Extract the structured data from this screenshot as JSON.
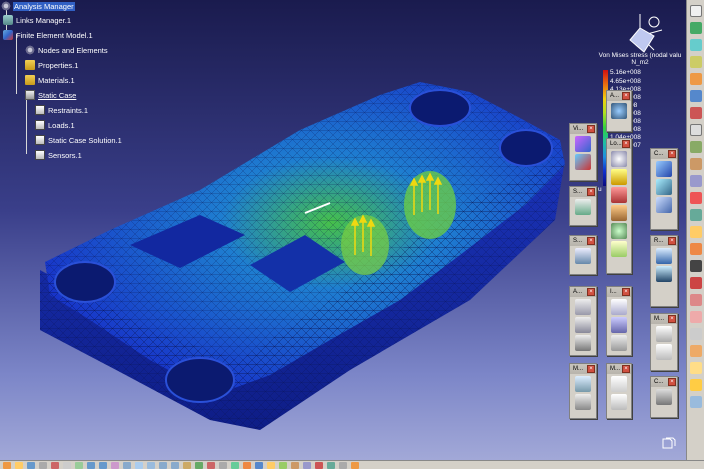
{
  "tree": {
    "items": [
      {
        "label": "Analysis Manager",
        "icon": "gear-icon"
      },
      {
        "label": "Links Manager.1",
        "icon": "link-icon"
      },
      {
        "label": "Finite Element Model.1",
        "icon": "fem-icon"
      },
      {
        "label": "Nodes and Elements",
        "icon": "gear-icon"
      },
      {
        "label": "Properties.1",
        "icon": "folder-icon"
      },
      {
        "label": "Materials.1",
        "icon": "folder-icon"
      },
      {
        "label": "Static Case",
        "icon": "case-icon"
      },
      {
        "label": "Restraints.1",
        "icon": "restraint-icon"
      },
      {
        "label": "Loads.1",
        "icon": "load-icon"
      },
      {
        "label": "Static Case Solution.1",
        "icon": "solution-icon"
      },
      {
        "label": "Sensors.1",
        "icon": "sensor-icon"
      }
    ]
  },
  "legend": {
    "title_line1": "Von Mises stress (nodal valu",
    "title_line2": "N_m2",
    "values": [
      "5.16e+008",
      "4.65e+008",
      "4.13e+008",
      "3.62e+008",
      "3.1e+008",
      "2.59e+008",
      "2.07e+008",
      "1.56e+008",
      "1.04e+008",
      "5.29e+007"
    ],
    "footer": "Bou"
  },
  "toolbars": {
    "labels": [
      "A...",
      "Vi...",
      "Lo...",
      "C...",
      "S...",
      "R...",
      "S...",
      "A...",
      "I...",
      "M...",
      "M...",
      "M...",
      "C..."
    ]
  },
  "colors": {
    "background_top": "#1a1b4e",
    "background_bottom": "#a6acd9",
    "mesh_primary": "#1f3ad0",
    "stress_high": "#d01010",
    "selection": "#3160c4"
  }
}
